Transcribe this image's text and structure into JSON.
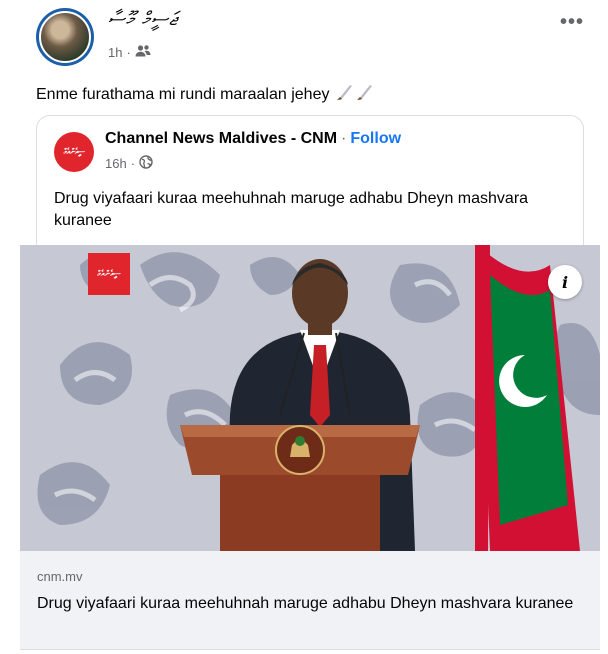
{
  "post": {
    "author_name": "ޖަސީމް މޫސާ",
    "time": "1h",
    "separator": "·",
    "audience_icon": "friends-icon",
    "more_icon": "more-horizontal-icon",
    "more_label": "•••",
    "caption": "Enme furathama mi rundi maraalan jehey",
    "caption_emoji_icon": "dagger-emoji-icon"
  },
  "shared": {
    "page_name": "Channel News Maldives - CNM",
    "dot": "·",
    "follow_label": "Follow",
    "time": "16h",
    "separator": "·",
    "audience_icon": "globe-icon",
    "text": "Drug viyafaari kuraa meehuhnah maruge adhabu Dheyn mashvara kuranee",
    "logo_text": "ސީއެންއެމް"
  },
  "image": {
    "info_label": "i",
    "logo_text": "ސީއެންއެމް",
    "colors": {
      "background": "#c6c9d4",
      "pattern": "#8e93a8",
      "suit": "#1f2531",
      "tie": "#c62026",
      "podium": "#8a3b22",
      "flag_red": "#d21034",
      "flag_green": "#007e3a"
    }
  },
  "link_preview": {
    "domain": "cnm.mv",
    "title": "Drug viyafaari kuraa meehuhnah maruge adhabu Dheyn mashvara kuranee"
  }
}
